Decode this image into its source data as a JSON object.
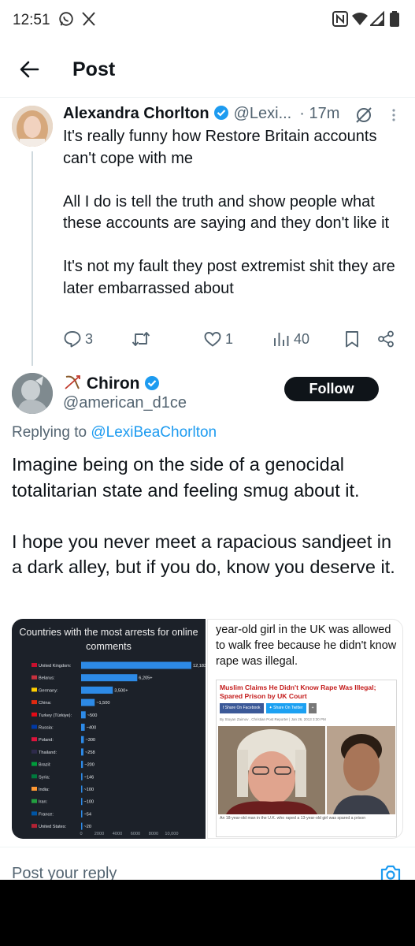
{
  "status_bar": {
    "time": "12:51",
    "left_icons": [
      "whatsapp-icon",
      "x-logo-icon"
    ],
    "right_icons": [
      "nfc-icon",
      "wifi-icon",
      "signal-icon",
      "battery-icon"
    ]
  },
  "header": {
    "title": "Post"
  },
  "tweet_parent": {
    "name": "Alexandra Chorlton",
    "handle": "@Lexi...",
    "separator": "·",
    "time": "17m",
    "paragraphs": [
      "It's really funny how Restore Britain accounts can't cope with me",
      "All I do is tell the truth and show people what these accounts are saying and they don't like it",
      "It's not my fault they post extremist shit they are later embarrassed about"
    ],
    "stats": {
      "replies": "3",
      "reposts": "",
      "likes": "1",
      "views": "40"
    }
  },
  "tweet_reply": {
    "name": "Chiron",
    "handle": "@american_d1ce",
    "follow_label": "Follow",
    "replying_prefix": "Replying to",
    "replying_mention": "@LexiBeaChorlton",
    "paragraphs": [
      "Imagine being on the side of a genocidal totalitarian state and feeling smug about it.",
      "I hope you never meet a rapacious sandjeet in a dark alley, but if you do, know you deserve it."
    ]
  },
  "media": {
    "left_chart_title": "Countries with the most arrests for online comments",
    "article_lead": "year-old girl in the UK was allowed to walk free because he didn't know rape was illegal.",
    "article_headline": "Muslim Claims He Didn't Know Rape Was Illegal; Spared Prison by UK Court",
    "share_facebook": "Share On Facebook",
    "share_twitter": "Share On Twitter",
    "share_plus": "+",
    "byline": "By Stoyan Zaimov , Christian Post Reporter | Jan 26, 2013 3:30 PM",
    "caption": "An 18-year-old man in the U.K. who raped a 13-year-old girl was spared a prison"
  },
  "chart_data": {
    "type": "bar",
    "title": "Countries with the most arrests for online comments",
    "orientation": "horizontal",
    "categories": [
      "United Kingdom:",
      "Belarus:",
      "Germany:",
      "China:",
      "Turkey (Türkiye):",
      "Russia:",
      "Poland:",
      "Thailand:",
      "Brazil:",
      "Syria:",
      "India:",
      "Iran:",
      "France:",
      "United States:"
    ],
    "values": [
      12183,
      6205,
      3500,
      1500,
      500,
      400,
      300,
      258,
      200,
      146,
      100,
      100,
      54,
      20
    ],
    "value_labels": [
      "12,183+",
      "6,205+",
      "3,500+",
      "~1,500",
      "~500",
      "~400",
      "~300",
      "~258",
      "~200",
      "~146",
      "~100",
      "~100",
      "~54",
      "~20"
    ],
    "xticks": [
      "0",
      "2000",
      "4000",
      "6000",
      "8000",
      "10,000"
    ],
    "xlim": [
      0,
      12183
    ],
    "bar_color": "#2d8ae6",
    "background": "#1c2129"
  },
  "reply_bar": {
    "placeholder": "Post your reply"
  },
  "colors": {
    "accent": "#1d9bf0",
    "text": "#0f1419",
    "muted": "#536471",
    "follow_bg": "#0f1419"
  }
}
